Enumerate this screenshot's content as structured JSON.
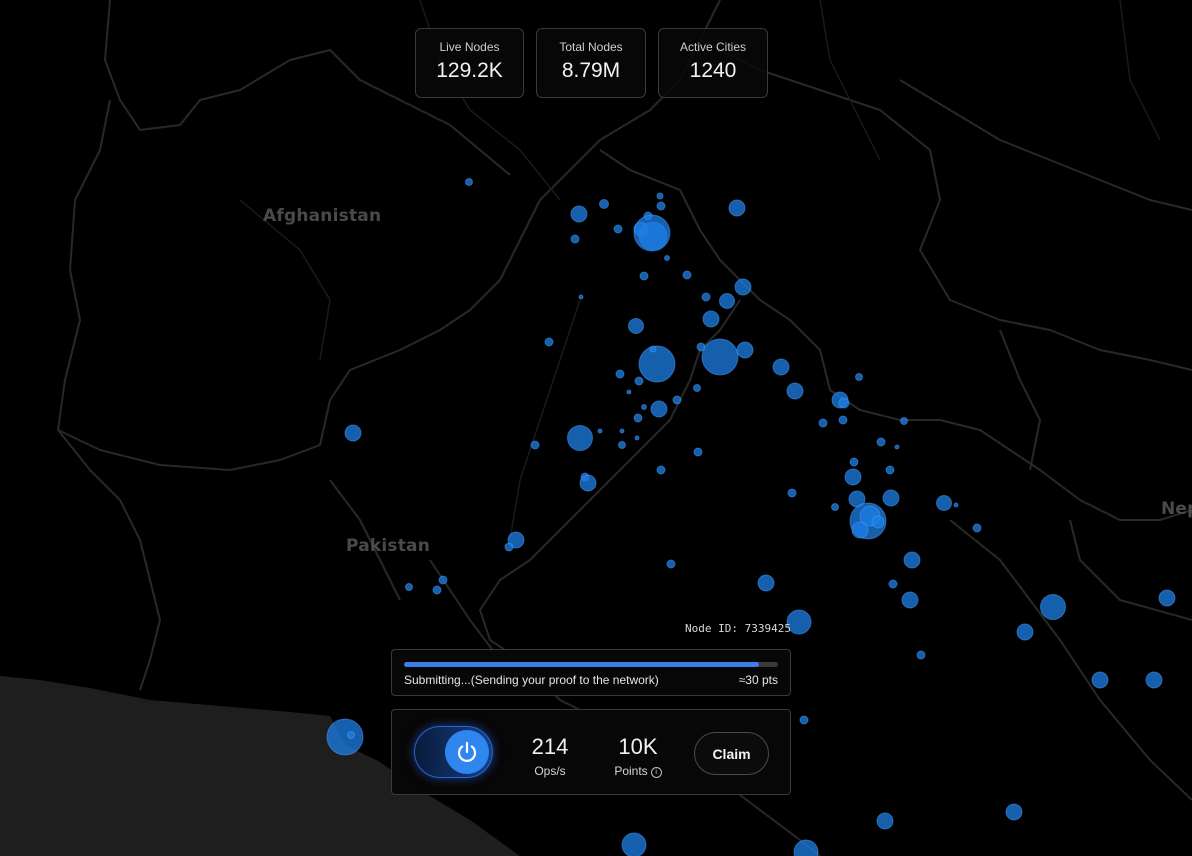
{
  "map": {
    "country_labels": [
      "Afghanistan",
      "Pakistan",
      "Nep"
    ]
  },
  "stats": [
    {
      "label": "Live Nodes",
      "value": "129.2K"
    },
    {
      "label": "Total Nodes",
      "value": "8.79M"
    },
    {
      "label": "Active Cities",
      "value": "1240"
    }
  ],
  "node": {
    "id_text": "Node ID: 7339425"
  },
  "progress": {
    "fraction": 0.95,
    "status": "Submitting...(Sending your proof to the network)",
    "points": "≈30 pts"
  },
  "controls": {
    "power_on": true,
    "ops_value": "214",
    "ops_label": "Ops/s",
    "points_value": "10K",
    "points_label": "Points",
    "info_glyph": "i",
    "claim_label": "Claim"
  },
  "icons": {
    "power": "power-icon",
    "info": "info-icon"
  },
  "colors": {
    "accent": "#2f86ee",
    "node_dot": "#1e7fe6",
    "background": "#000000",
    "land_border": "#2a2a2a"
  }
}
